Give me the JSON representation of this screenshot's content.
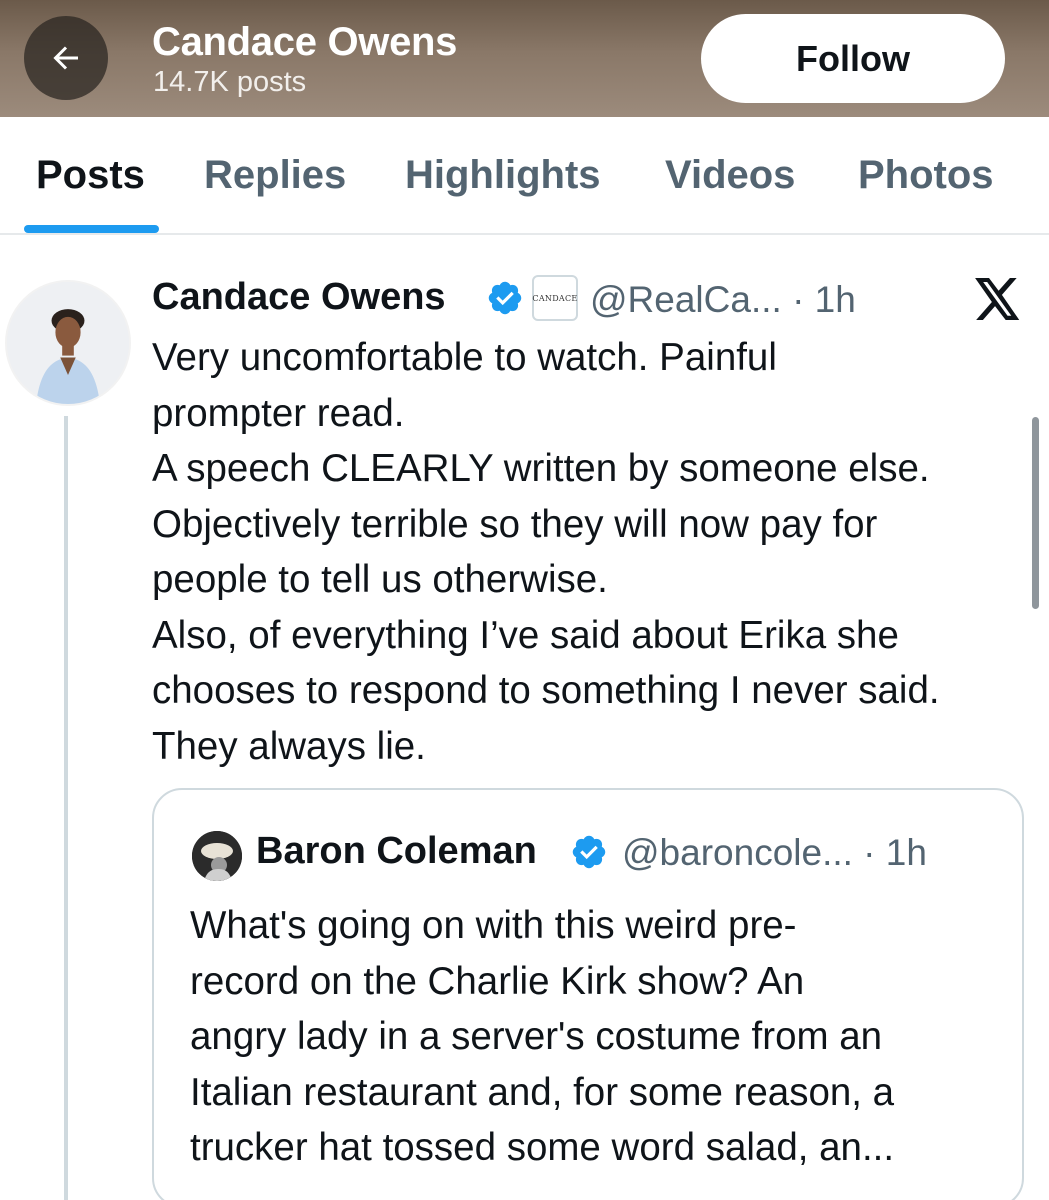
{
  "header": {
    "name": "Candace Owens",
    "post_count": "14.7K posts",
    "follow_label": "Follow"
  },
  "tabs": [
    {
      "label": "Posts",
      "active": true
    },
    {
      "label": "Replies",
      "active": false
    },
    {
      "label": "Highlights",
      "active": false
    },
    {
      "label": "Videos",
      "active": false
    },
    {
      "label": "Photos",
      "active": false
    }
  ],
  "post": {
    "author_name": "Candace Owens",
    "affiliate_badge_text": "CANDACE",
    "handle_time": "@RealCa... · 1h",
    "text": "Very uncomfortable to watch. Painful\nprompter read.\nA speech CLEARLY written by someone else.\nObjectively terrible so they will now pay for\npeople to tell us otherwise.\nAlso, of everything I’ve said about Erika she\nchooses to respond to something I never said.\nThey always lie.",
    "quote": {
      "author_name": "Baron Coleman",
      "handle_time": "@baroncole... · 1h",
      "text": "What's going on with this weird pre-\nrecord on the Charlie Kirk show?  An\nangry lady in a server's costume from an\nItalian restaurant and, for some reason, a\ntrucker hat tossed some word salad, an..."
    }
  },
  "colors": {
    "accent": "#1d9bf0",
    "text_primary": "#0f1419",
    "text_secondary": "#536471",
    "border": "#cfd9de"
  },
  "icons": {
    "back": "arrow-left-icon",
    "verified": "verified-badge-icon",
    "platform": "x-logo-icon"
  }
}
